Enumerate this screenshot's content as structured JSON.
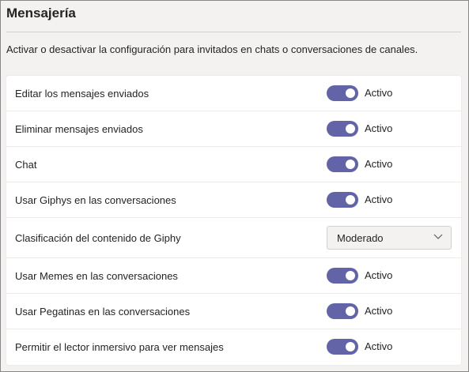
{
  "section": {
    "title": "Mensajería",
    "description": "Activar o desactivar la configuración para invitados en chats o conversaciones de canales."
  },
  "settings": [
    {
      "label": "Editar los mensajes enviados",
      "type": "toggle",
      "state": "Activo",
      "on": true
    },
    {
      "label": "Eliminar mensajes enviados",
      "type": "toggle",
      "state": "Activo",
      "on": true
    },
    {
      "label": "Chat",
      "type": "toggle",
      "state": "Activo",
      "on": true
    },
    {
      "label": "Usar Giphys en las conversaciones",
      "type": "toggle",
      "state": "Activo",
      "on": true
    },
    {
      "label": "Clasificación del contenido de Giphy",
      "type": "dropdown",
      "value": "Moderado"
    },
    {
      "label": "Usar Memes en las conversaciones",
      "type": "toggle",
      "state": "Activo",
      "on": true
    },
    {
      "label": "Usar Pegatinas en las conversaciones",
      "type": "toggle",
      "state": "Activo",
      "on": true
    },
    {
      "label": "Permitir el lector inmersivo para ver mensajes",
      "type": "toggle",
      "state": "Activo",
      "on": true
    }
  ],
  "colors": {
    "accent": "#6264a7",
    "background": "#f3f2f1",
    "card": "#ffffff"
  },
  "icons": {
    "dropdown": "chevron-down-icon"
  }
}
